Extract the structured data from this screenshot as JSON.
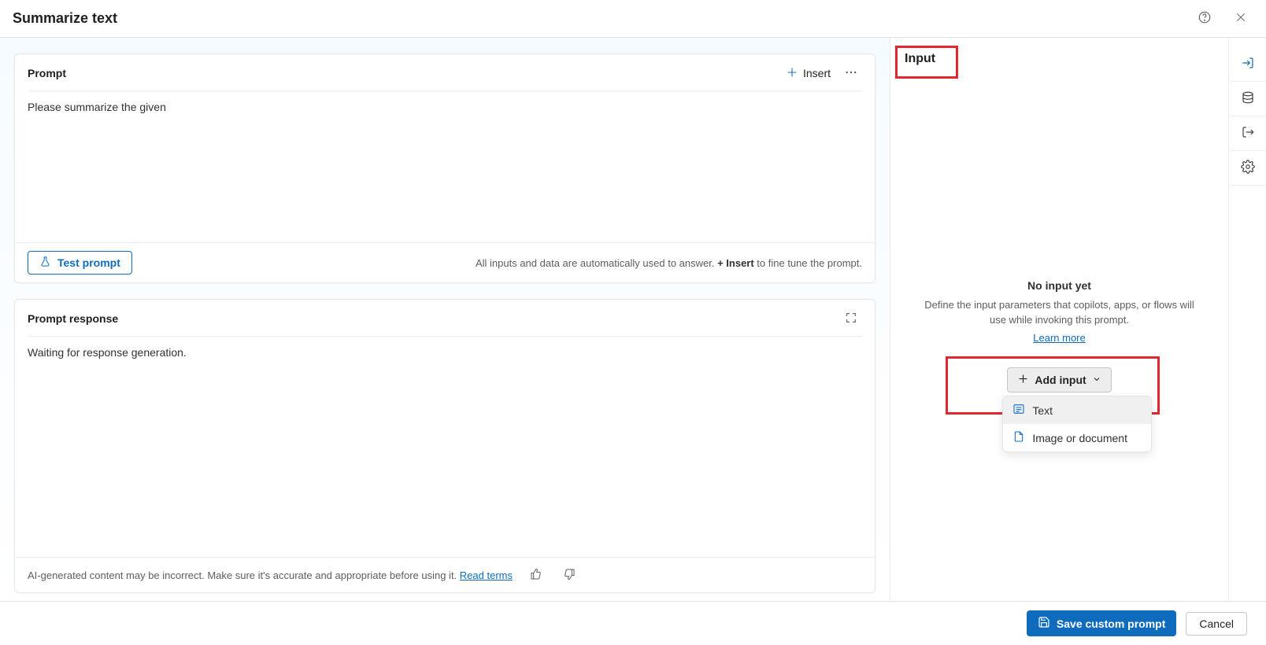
{
  "header": {
    "title": "Summarize text"
  },
  "prompt_card": {
    "title": "Prompt",
    "insert_label": "Insert",
    "body_text": "Please summarize the given",
    "test_label": "Test prompt",
    "hint_pre": "All inputs and data are automatically used to answer. ",
    "hint_bold": "+ Insert",
    "hint_post": " to fine tune the prompt."
  },
  "response_card": {
    "title": "Prompt response",
    "body_text": "Waiting for response generation.",
    "disclaimer": "AI-generated content may be incorrect. Make sure it's accurate and appropriate before using it. ",
    "read_terms": "Read terms"
  },
  "right_panel": {
    "tab_label": "Input",
    "empty_title": "No input yet",
    "empty_desc": "Define the input parameters that copilots, apps, or flows will use while invoking this prompt.",
    "learn_more": "Learn more",
    "add_input_label": "Add input",
    "dropdown": {
      "text": "Text",
      "image_doc": "Image or document"
    }
  },
  "footer": {
    "save_label": "Save custom prompt",
    "cancel_label": "Cancel"
  }
}
